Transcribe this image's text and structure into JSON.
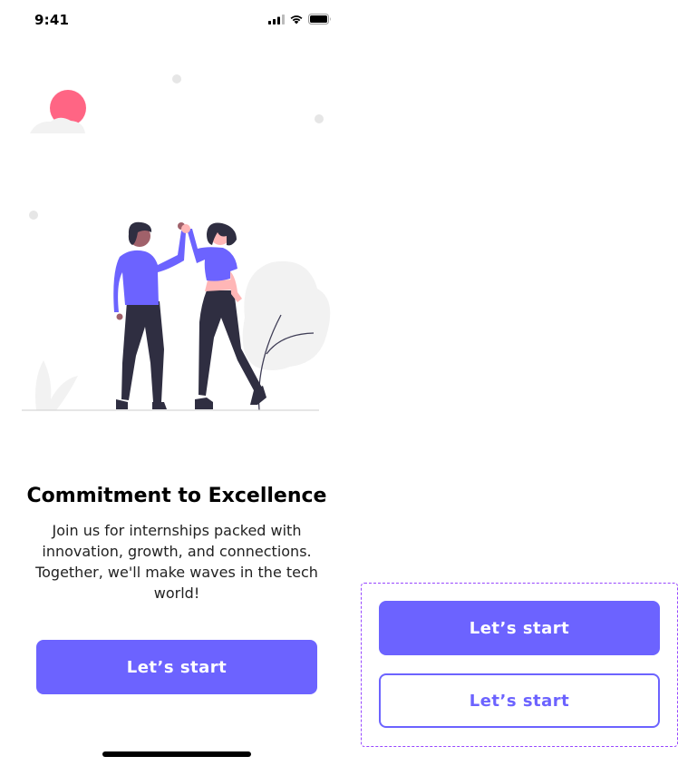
{
  "status_bar": {
    "time": "9:41"
  },
  "onboarding": {
    "title": "Commitment to Excellence",
    "description": "Join us for internships packed with innovation, growth, and connections. Together, we'll make waves in the tech world!",
    "primary_button_label": "Let’s start"
  },
  "variants": {
    "primary_label": "Let’s start",
    "outline_label": "Let’s start"
  },
  "colors": {
    "accent": "#6c63ff",
    "sun": "#ff6584",
    "figure_dark": "#2f2e41",
    "foliage": "#f2f2f2"
  }
}
